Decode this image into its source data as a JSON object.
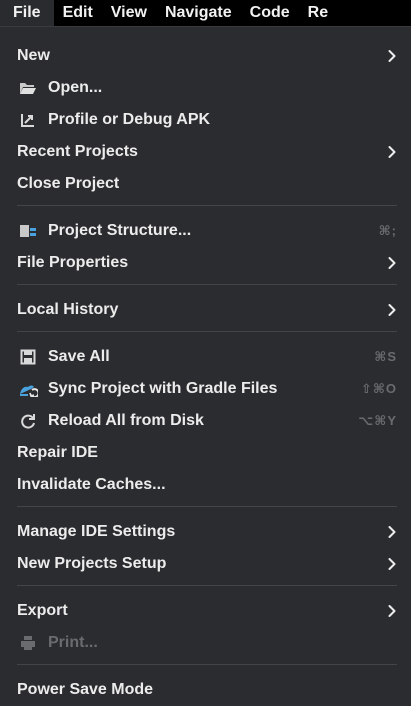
{
  "menubar": {
    "items": [
      "File",
      "Edit",
      "View",
      "Navigate",
      "Code",
      "Re"
    ]
  },
  "menu": {
    "new": {
      "label": "New"
    },
    "open": {
      "label": "Open...",
      "icon": "folder-icon"
    },
    "profile_debug": {
      "label": "Profile or Debug APK",
      "icon": "profile-apk-icon"
    },
    "recent_projects": {
      "label": "Recent Projects"
    },
    "close_project": {
      "label": "Close Project"
    },
    "project_structure": {
      "label": "Project Structure...",
      "icon": "project-structure-icon",
      "shortcut": "⌘;"
    },
    "file_properties": {
      "label": "File Properties"
    },
    "local_history": {
      "label": "Local History"
    },
    "save_all": {
      "label": "Save All",
      "icon": "save-icon",
      "shortcut": "⌘S"
    },
    "sync_gradle": {
      "label": "Sync Project with Gradle Files",
      "icon": "gradle-sync-icon",
      "shortcut": "⇧⌘O"
    },
    "reload_disk": {
      "label": "Reload All from Disk",
      "icon": "reload-icon",
      "shortcut": "⌥⌘Y"
    },
    "repair_ide": {
      "label": "Repair IDE"
    },
    "invalidate_caches": {
      "label": "Invalidate Caches..."
    },
    "manage_ide_settings": {
      "label": "Manage IDE Settings"
    },
    "new_projects_setup": {
      "label": "New Projects Setup"
    },
    "export": {
      "label": "Export"
    },
    "print": {
      "label": "Print...",
      "icon": "printer-icon",
      "disabled": true
    },
    "power_save_mode": {
      "label": "Power Save Mode"
    }
  },
  "colors": {
    "menubar_bg": "#000000",
    "menu_bg": "#2b2c2f",
    "text": "#ececec",
    "muted": "#6a6b6f",
    "separator": "#44454a",
    "gradle_icon_blue": "#4aa3df"
  }
}
